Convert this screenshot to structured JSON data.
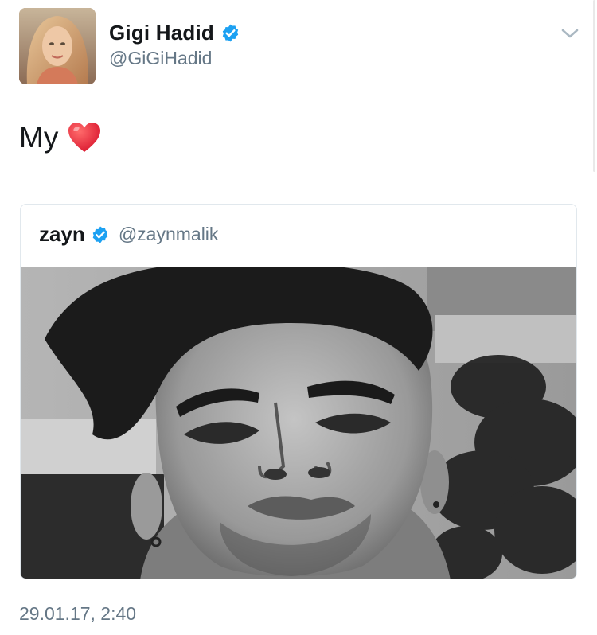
{
  "tweet": {
    "author": {
      "name": "Gigi Hadid",
      "handle": "@GiGiHadid",
      "verified": true
    },
    "text": "My",
    "emoji": "heart-icon",
    "timestamp": "29.01.17, 2:40",
    "menu_icon": "chevron-down-icon"
  },
  "quoted_tweet": {
    "author": {
      "name": "zayn",
      "handle": "@zaynmalik",
      "verified": true
    },
    "media": "black-and-white selfie photo"
  },
  "colors": {
    "verified_blue": "#1da1f2",
    "secondary_text": "#657786",
    "border": "#e1e8ed",
    "heart_red": "#e0245e"
  }
}
